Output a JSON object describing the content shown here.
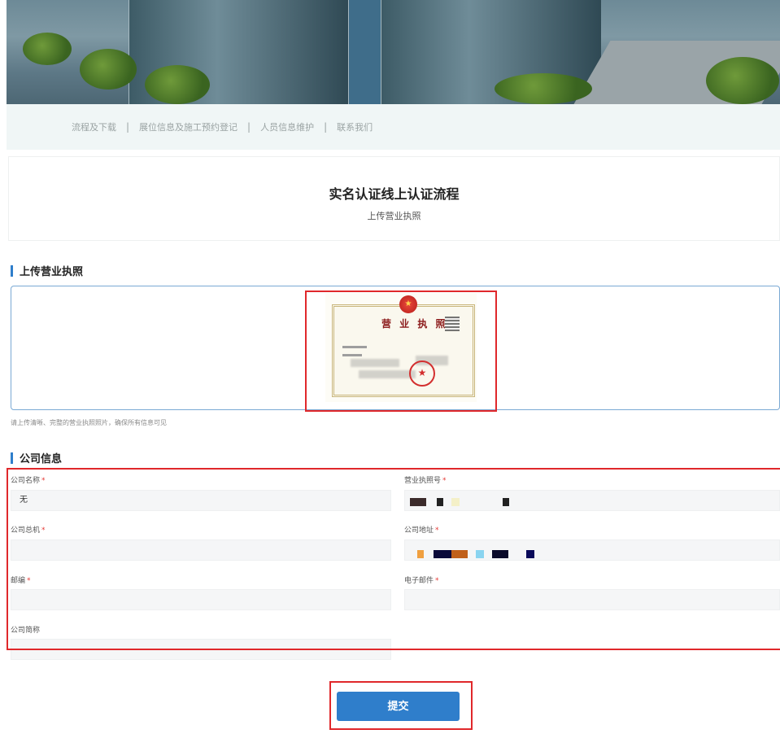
{
  "nav": {
    "items": [
      "流程及下载",
      "展位信息及施工预约登记",
      "人员信息维护",
      "联系我们"
    ],
    "separator": "|"
  },
  "title": {
    "main": "实名认证线上认证流程",
    "sub": "上传营业执照"
  },
  "upload_section": {
    "heading": "上传营业执照",
    "hint": "请上传清晰、完整的营业执照照片，确保所有信息可见",
    "license_title": "营 业 执 照"
  },
  "company_section": {
    "heading": "公司信息",
    "fields": {
      "company_name": {
        "label": "公司名称",
        "value": "无"
      },
      "license_number": {
        "label": "营业执照号",
        "value": ""
      },
      "company_phone": {
        "label": "公司总机",
        "value": ""
      },
      "company_address": {
        "label": "公司地址",
        "value": ""
      },
      "postal_code": {
        "label": "邮编",
        "value": ""
      },
      "email": {
        "label": "电子邮件",
        "value": ""
      },
      "company_short_name": {
        "label": "公司简称",
        "value": ""
      }
    },
    "required_mark": "*"
  },
  "submit_label": "提交",
  "colors": {
    "accent": "#2f7ecb",
    "highlight": "#e0282b",
    "nav_bg": "#f0f6f6"
  }
}
